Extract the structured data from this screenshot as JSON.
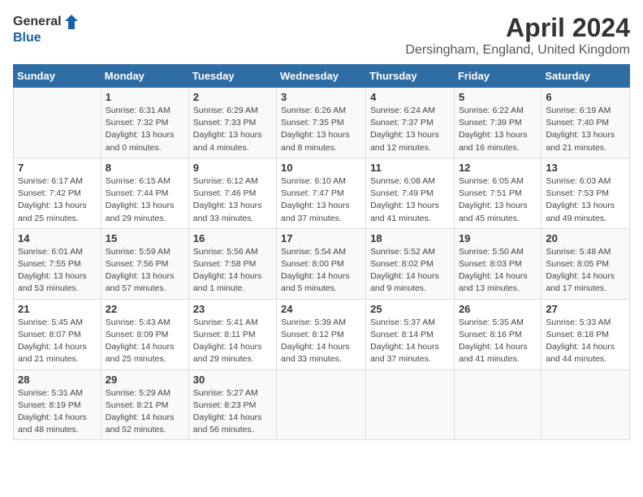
{
  "header": {
    "logo_general": "General",
    "logo_blue": "Blue",
    "month": "April 2024",
    "location": "Dersingham, England, United Kingdom"
  },
  "weekdays": [
    "Sunday",
    "Monday",
    "Tuesday",
    "Wednesday",
    "Thursday",
    "Friday",
    "Saturday"
  ],
  "weeks": [
    [
      {
        "day": "",
        "info": ""
      },
      {
        "day": "1",
        "info": "Sunrise: 6:31 AM\nSunset: 7:32 PM\nDaylight: 13 hours\nand 0 minutes."
      },
      {
        "day": "2",
        "info": "Sunrise: 6:29 AM\nSunset: 7:33 PM\nDaylight: 13 hours\nand 4 minutes."
      },
      {
        "day": "3",
        "info": "Sunrise: 6:26 AM\nSunset: 7:35 PM\nDaylight: 13 hours\nand 8 minutes."
      },
      {
        "day": "4",
        "info": "Sunrise: 6:24 AM\nSunset: 7:37 PM\nDaylight: 13 hours\nand 12 minutes."
      },
      {
        "day": "5",
        "info": "Sunrise: 6:22 AM\nSunset: 7:39 PM\nDaylight: 13 hours\nand 16 minutes."
      },
      {
        "day": "6",
        "info": "Sunrise: 6:19 AM\nSunset: 7:40 PM\nDaylight: 13 hours\nand 21 minutes."
      }
    ],
    [
      {
        "day": "7",
        "info": "Sunrise: 6:17 AM\nSunset: 7:42 PM\nDaylight: 13 hours\nand 25 minutes."
      },
      {
        "day": "8",
        "info": "Sunrise: 6:15 AM\nSunset: 7:44 PM\nDaylight: 13 hours\nand 29 minutes."
      },
      {
        "day": "9",
        "info": "Sunrise: 6:12 AM\nSunset: 7:46 PM\nDaylight: 13 hours\nand 33 minutes."
      },
      {
        "day": "10",
        "info": "Sunrise: 6:10 AM\nSunset: 7:47 PM\nDaylight: 13 hours\nand 37 minutes."
      },
      {
        "day": "11",
        "info": "Sunrise: 6:08 AM\nSunset: 7:49 PM\nDaylight: 13 hours\nand 41 minutes."
      },
      {
        "day": "12",
        "info": "Sunrise: 6:05 AM\nSunset: 7:51 PM\nDaylight: 13 hours\nand 45 minutes."
      },
      {
        "day": "13",
        "info": "Sunrise: 6:03 AM\nSunset: 7:53 PM\nDaylight: 13 hours\nand 49 minutes."
      }
    ],
    [
      {
        "day": "14",
        "info": "Sunrise: 6:01 AM\nSunset: 7:55 PM\nDaylight: 13 hours\nand 53 minutes."
      },
      {
        "day": "15",
        "info": "Sunrise: 5:59 AM\nSunset: 7:56 PM\nDaylight: 13 hours\nand 57 minutes."
      },
      {
        "day": "16",
        "info": "Sunrise: 5:56 AM\nSunset: 7:58 PM\nDaylight: 14 hours\nand 1 minute."
      },
      {
        "day": "17",
        "info": "Sunrise: 5:54 AM\nSunset: 8:00 PM\nDaylight: 14 hours\nand 5 minutes."
      },
      {
        "day": "18",
        "info": "Sunrise: 5:52 AM\nSunset: 8:02 PM\nDaylight: 14 hours\nand 9 minutes."
      },
      {
        "day": "19",
        "info": "Sunrise: 5:50 AM\nSunset: 8:03 PM\nDaylight: 14 hours\nand 13 minutes."
      },
      {
        "day": "20",
        "info": "Sunrise: 5:48 AM\nSunset: 8:05 PM\nDaylight: 14 hours\nand 17 minutes."
      }
    ],
    [
      {
        "day": "21",
        "info": "Sunrise: 5:45 AM\nSunset: 8:07 PM\nDaylight: 14 hours\nand 21 minutes."
      },
      {
        "day": "22",
        "info": "Sunrise: 5:43 AM\nSunset: 8:09 PM\nDaylight: 14 hours\nand 25 minutes."
      },
      {
        "day": "23",
        "info": "Sunrise: 5:41 AM\nSunset: 8:11 PM\nDaylight: 14 hours\nand 29 minutes."
      },
      {
        "day": "24",
        "info": "Sunrise: 5:39 AM\nSunset: 8:12 PM\nDaylight: 14 hours\nand 33 minutes."
      },
      {
        "day": "25",
        "info": "Sunrise: 5:37 AM\nSunset: 8:14 PM\nDaylight: 14 hours\nand 37 minutes."
      },
      {
        "day": "26",
        "info": "Sunrise: 5:35 AM\nSunset: 8:16 PM\nDaylight: 14 hours\nand 41 minutes."
      },
      {
        "day": "27",
        "info": "Sunrise: 5:33 AM\nSunset: 8:18 PM\nDaylight: 14 hours\nand 44 minutes."
      }
    ],
    [
      {
        "day": "28",
        "info": "Sunrise: 5:31 AM\nSunset: 8:19 PM\nDaylight: 14 hours\nand 48 minutes."
      },
      {
        "day": "29",
        "info": "Sunrise: 5:29 AM\nSunset: 8:21 PM\nDaylight: 14 hours\nand 52 minutes."
      },
      {
        "day": "30",
        "info": "Sunrise: 5:27 AM\nSunset: 8:23 PM\nDaylight: 14 hours\nand 56 minutes."
      },
      {
        "day": "",
        "info": ""
      },
      {
        "day": "",
        "info": ""
      },
      {
        "day": "",
        "info": ""
      },
      {
        "day": "",
        "info": ""
      }
    ]
  ]
}
